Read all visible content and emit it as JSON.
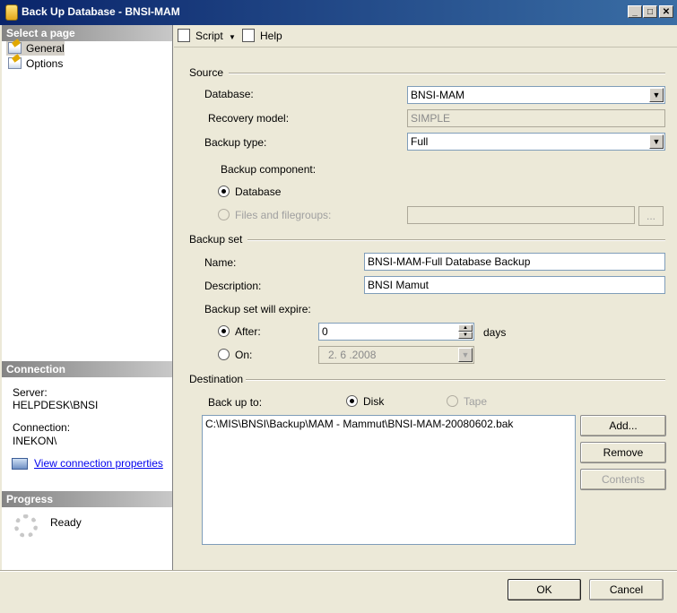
{
  "window": {
    "title": "Back Up Database - BNSI-MAM"
  },
  "title_buttons": {
    "minimize": "_",
    "maximize": "□",
    "close": "✕"
  },
  "left": {
    "select_page_header": "Select a page",
    "pages": [
      "General",
      "Options"
    ],
    "connection_header": "Connection",
    "server_label": "Server:",
    "server_value": "HELPDESK\\BNSI",
    "connection_label": "Connection:",
    "connection_value": "INEKON\\",
    "view_connection_link": "View connection properties",
    "progress_header": "Progress",
    "progress_status": "Ready"
  },
  "toolbar": {
    "script_label": "Script",
    "help_label": "Help"
  },
  "source": {
    "group_label": "Source",
    "database_label": "Database:",
    "database_value": "BNSI-MAM",
    "recovery_model_label": "Recovery model:",
    "recovery_model_value": "SIMPLE",
    "backup_type_label": "Backup type:",
    "backup_type_value": "Full",
    "backup_component_label": "Backup component:",
    "component_database": "Database",
    "component_files": "Files and filegroups:",
    "files_button": "..."
  },
  "backup_set": {
    "group_label": "Backup set",
    "name_label": "Name:",
    "name_value": "BNSI-MAM-Full Database Backup",
    "description_label": "Description:",
    "description_value": "BNSI Mamut",
    "expire_label": "Backup set will expire:",
    "after_label": "After:",
    "after_value": "0",
    "days_label": "days",
    "on_label": "On:",
    "on_value": "2. 6 .2008"
  },
  "destination": {
    "group_label": "Destination",
    "backup_to_label": "Back up to:",
    "disk_label": "Disk",
    "tape_label": "Tape",
    "paths": [
      "C:\\MIS\\BNSI\\Backup\\MAM - Mammut\\BNSI-MAM-20080602.bak"
    ],
    "add_button": "Add...",
    "remove_button": "Remove",
    "contents_button": "Contents"
  },
  "footer": {
    "ok_button": "OK",
    "cancel_button": "Cancel"
  },
  "colors": {
    "titlebar": "#0a246a",
    "dialog_bg": "#ece9d8",
    "link": "#0000ee"
  }
}
